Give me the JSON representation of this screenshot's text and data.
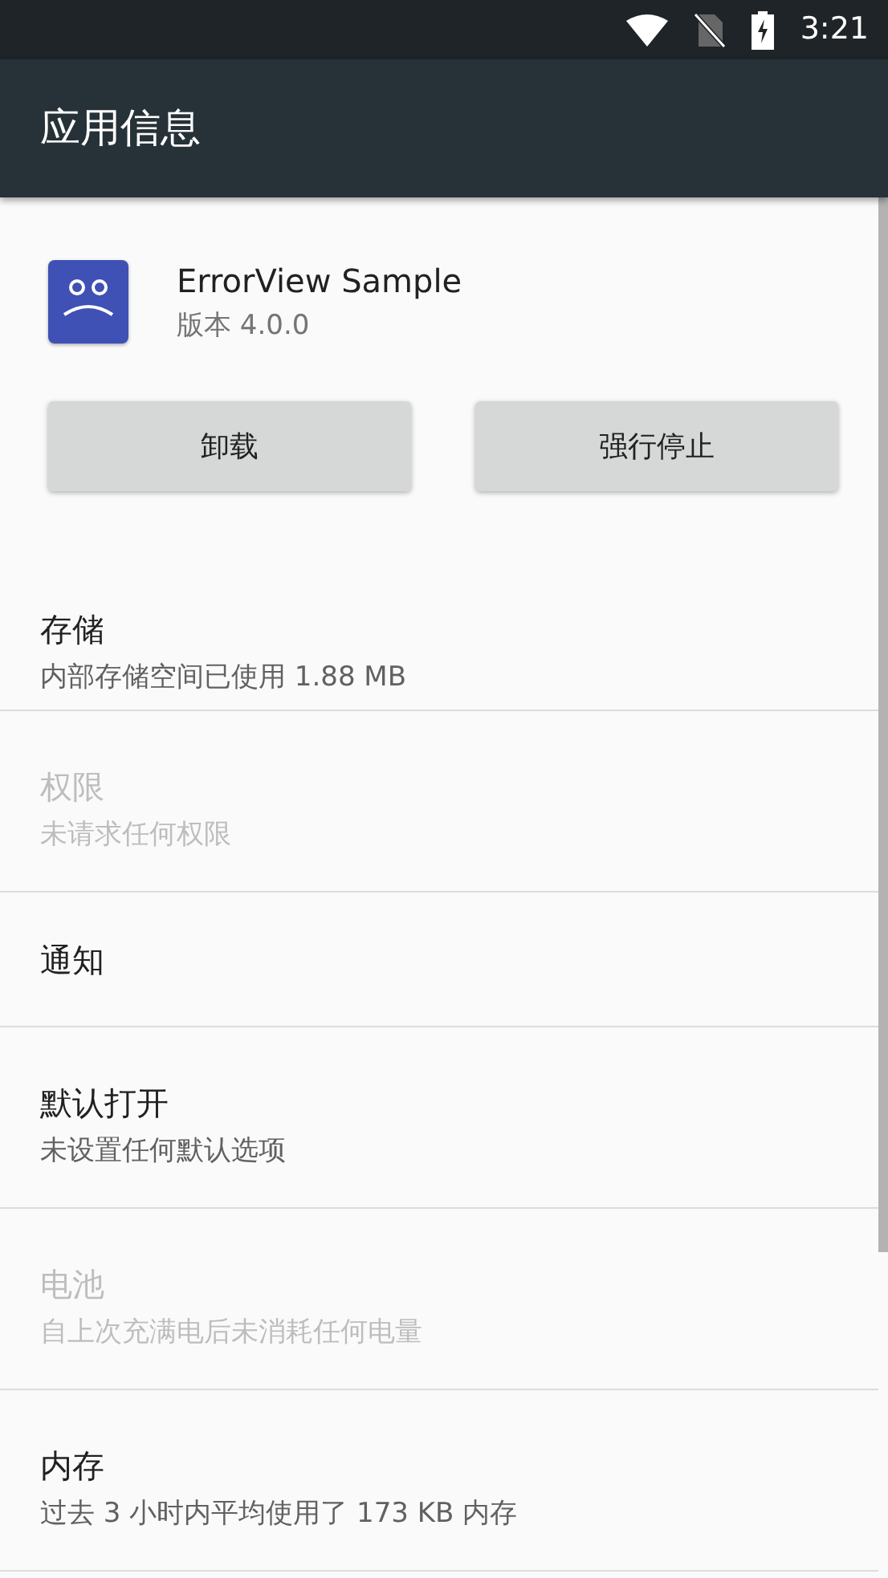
{
  "status_bar": {
    "time": "3:21"
  },
  "toolbar": {
    "title": "应用信息"
  },
  "app": {
    "name": "ErrorView Sample",
    "version": "版本 4.0.0"
  },
  "buttons": [
    "卸载",
    "强行停止"
  ],
  "settings": [
    {
      "title": "存储",
      "summary": "内部存储空间已使用 1.88 MB",
      "disabled": false
    },
    {
      "title": "权限",
      "summary": "未请求任何权限",
      "disabled": true
    },
    {
      "title": "通知",
      "disabled": false
    },
    {
      "title": "默认打开",
      "summary": "未设置任何默认选项",
      "disabled": false
    },
    {
      "title": "电池",
      "summary": "自上次充满电后未消耗任何电量",
      "disabled": true
    },
    {
      "title": "内存",
      "summary": "过去 3 小时内平均使用了 173 KB 内存",
      "disabled": false
    }
  ]
}
